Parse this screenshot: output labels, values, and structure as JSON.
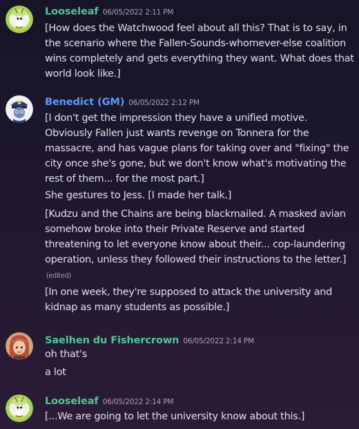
{
  "messages": [
    {
      "author": "Looseleaf",
      "author_color": "#4ec794",
      "timestamp": "06/05/2022 2:11 PM",
      "avatar_icon": "moth-avatar",
      "paragraphs": [
        "[How does the Watchwood feel about all this? That is to say, in the scenario where the Fallen-Sounds-whomever-else coalition wins completely and gets everything they want. What does that world look like.]"
      ]
    },
    {
      "author": "Benedict (GM)",
      "author_color": "#5a9cf2",
      "timestamp": "06/05/2022 2:12 PM",
      "avatar_icon": "police-officer-avatar",
      "paragraphs": [
        "[I don't get the impression they have a unified motive. Obviously Fallen just wants revenge on Tonnera for the massacre, and has vague plans for taking over and \"fixing\" the city once she's gone, but we don't know what's motivating the rest of them... for the most part.]",
        "She gestures to Jess. [I made her talk.]",
        "[Kudzu and the Chains are being blackmailed. A masked avian somehow broke into their Private Reserve and started threatening to let everyone know about their... cop-laundering operation, unless they followed their instructions to the letter.]",
        "[In one week, they're supposed to attack the university and kidnap as many students as possible.]"
      ],
      "edited_label": "(edited)"
    },
    {
      "author": "Saelhen du Fishercrown",
      "author_color": "#4ec794",
      "timestamp": "06/05/2022 2:14 PM",
      "avatar_icon": "red-haired-character-avatar",
      "paragraphs": [
        "oh that's",
        "a lot"
      ]
    },
    {
      "author": "Looseleaf",
      "author_color": "#4ec794",
      "timestamp": "06/05/2022 2:14 PM",
      "avatar_icon": "moth-avatar",
      "paragraphs": [
        "[...We are going to let the university know about this.]"
      ]
    }
  ]
}
